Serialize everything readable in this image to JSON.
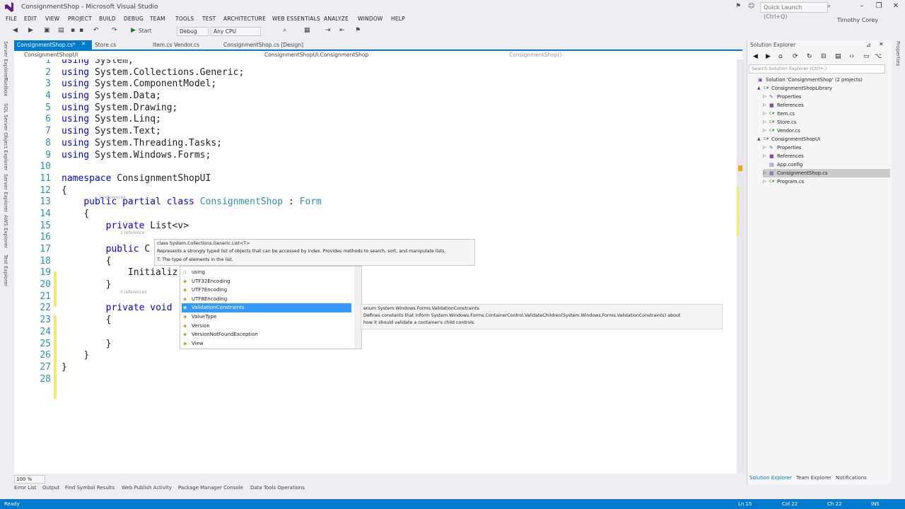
{
  "window": {
    "title": "ConsignmentShop - Microsoft Visual Studio",
    "quick_launch_placeholder": "Quick Launch (Ctrl+Q)",
    "user": "Timothy Corey"
  },
  "menu": [
    "FILE",
    "EDIT",
    "VIEW",
    "PROJECT",
    "BUILD",
    "DEBUG",
    "TEAM",
    "TOOLS",
    "TEST",
    "ARCHITECTURE",
    "WEB ESSENTIALS",
    "ANALYZE",
    "WINDOW",
    "HELP"
  ],
  "toolbar": {
    "start_label": "Start",
    "config": "Debug",
    "platform": "Any CPU"
  },
  "left_strip": [
    "Server Explorer",
    "Toolbox",
    "SQL Server Object Explorer",
    "Server Explorer",
    "AWS Explorer",
    "Test Explorer"
  ],
  "doc_tabs": [
    "ConsignmentShop.cs*",
    "Store.cs",
    "Item.cs",
    "Vendor.cs",
    "ConsignmentShop.cs [Design]"
  ],
  "nav_bar": {
    "project": "ConsignmentShopUI",
    "type": "ConsignmentShopUI.ConsignmentShop",
    "member": "ConsignmentShop()"
  },
  "code": {
    "line_numbers": [
      "1",
      "2",
      "3",
      "4",
      "5",
      "6",
      "7",
      "8",
      "9",
      "10",
      "11",
      "12",
      "13",
      "14",
      "15",
      "16",
      "17",
      "18",
      "19",
      "20",
      "21",
      "22",
      "23",
      "24",
      "25",
      "26",
      "27",
      "28"
    ],
    "using_kw": "using",
    "usings": [
      "System;",
      "System.Collections.Generic;",
      "System.ComponentModel;",
      "System.Data;",
      "System.Drawing;",
      "System.Linq;",
      "System.Text;",
      "System.Threading.Tasks;",
      "System.Windows.Forms;"
    ],
    "namespace_kw": "namespace",
    "namespace_name": "ConsignmentShopUI",
    "open_brace": "{",
    "close_brace": "}",
    "class_kw": "public partial class",
    "class_name": "ConsignmentShop",
    "class_sep": " : ",
    "base_class": "Form",
    "private_kw": "private",
    "field_type": "List<v>",
    "ctor_kw": "public",
    "ctor_name": "C",
    "init_call": "Initializ",
    "void_kw": "private void",
    "lens_refs": [
      "2 references",
      "1 reference",
      "0 references"
    ]
  },
  "tooltip": {
    "signature": "class System.Collections.Generic.List<T>",
    "description": "Represents a strongly typed list of objects that can be accessed by index. Provides methods to search, sort, and manipulate lists.",
    "param": "T: The type of elements in the list."
  },
  "completion": {
    "items": [
      "using",
      "UTF32Encoding",
      "UTF7Encoding",
      "UTF8Encoding",
      "ValidationConstraints",
      "ValueType",
      "Version",
      "VersionNotFoundException",
      "View"
    ],
    "selected_index": 4,
    "desc_line1": "enum System.Windows.Forms.ValidationConstraints",
    "desc_line2": "Defines constants that inform System.Windows.Forms.ContainerControl.ValidateChildren(System.Windows.Forms.ValidationConstraints) about",
    "desc_line3": "how it should validate a container's child controls."
  },
  "zoom": "100 %",
  "bottom_tabs": [
    "Error List",
    "Output",
    "Find Symbol Results",
    "Web Publish Activity",
    "Package Manager Console",
    "Data Tools Operations"
  ],
  "solution_explorer": {
    "title": "Solution Explorer",
    "search_placeholder": "Search Solution Explorer (Ctrl+;)",
    "nodes": [
      {
        "label": "Solution 'ConsignmentShop' (2 projects)",
        "depth": 0,
        "icon": "solution-icon",
        "arrow": ""
      },
      {
        "label": "ConsignmentShopLibrary",
        "depth": 1,
        "icon": "csproj-icon",
        "arrow": "▲"
      },
      {
        "label": "Properties",
        "depth": 2,
        "icon": "wrench-icon",
        "arrow": "▷"
      },
      {
        "label": "References",
        "depth": 2,
        "icon": "references-icon",
        "arrow": "▷"
      },
      {
        "label": "Item.cs",
        "depth": 2,
        "icon": "cs-file-icon",
        "arrow": "▷"
      },
      {
        "label": "Store.cs",
        "depth": 2,
        "icon": "cs-file-icon",
        "arrow": "▷"
      },
      {
        "label": "Vendor.cs",
        "depth": 2,
        "icon": "cs-file-icon",
        "arrow": "▷"
      },
      {
        "label": "ConsignmentShopUI",
        "depth": 1,
        "icon": "csproj-icon",
        "arrow": "▲"
      },
      {
        "label": "Properties",
        "depth": 2,
        "icon": "wrench-icon",
        "arrow": "▷"
      },
      {
        "label": "References",
        "depth": 2,
        "icon": "references-icon",
        "arrow": "▷"
      },
      {
        "label": "App.config",
        "depth": 2,
        "icon": "config-icon",
        "arrow": ""
      },
      {
        "label": "ConsignmentShop.cs",
        "depth": 2,
        "icon": "form-icon",
        "arrow": "▷"
      },
      {
        "label": "Program.cs",
        "depth": 2,
        "icon": "cs-file-icon",
        "arrow": "▷"
      }
    ],
    "selected_index": 11,
    "tabs": [
      "Solution Explorer",
      "Team Explorer",
      "Notifications"
    ]
  },
  "right_strip": [
    "Properties"
  ],
  "status": {
    "state": "Ready",
    "line": "Ln 15",
    "col": "Col 22",
    "ch": "Ch 22",
    "mode": "INS"
  },
  "colors": {
    "accent": "#007acc",
    "keyword": "#0000ff",
    "type": "#2b91af"
  }
}
